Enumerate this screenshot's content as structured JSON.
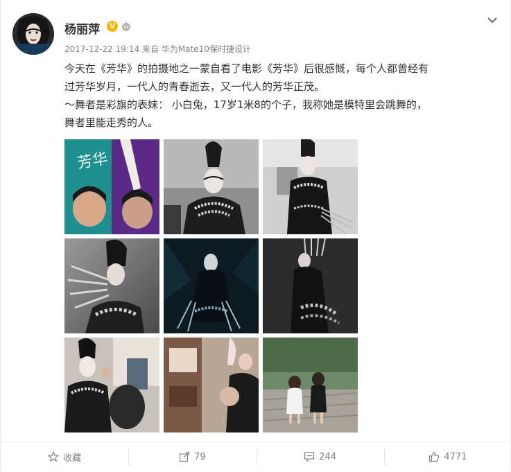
{
  "post": {
    "username": "杨丽萍",
    "verified_badge": "V",
    "timestamp": "2017-12-22 19:14",
    "source_prefix": "来自",
    "source": "华为Mate10保时捷设计",
    "text_line1": "今天在《芳华》的拍摄地之一蒙自看了电影《芳华》后很感慨，每个人都曾经有",
    "text_line2": "过芳华岁月，一代人的青春逝去，又一代人的芳华正茂。",
    "text_line3": "～舞者是彩旗的表妹： 小白兔，17岁1米8的个子，我称她是模特里会跳舞的，",
    "text_line4": "舞者里能走秀的人。",
    "poster_text": "芳华"
  },
  "icons": {
    "menu": "chevron-down-icon",
    "robot": "robot-icon",
    "favorite": "star-icon",
    "repost": "share-icon",
    "comment": "comment-icon",
    "like": "thumbs-up-icon"
  },
  "actions": {
    "favorite_label": "收藏",
    "repost_count": "79",
    "comment_count": "244",
    "like_count": "4771"
  },
  "colors": {
    "accent": "#f7b300",
    "text": "#333333",
    "muted": "#808080",
    "poster_teal": "#1f8f8f",
    "poster_purple": "#5b2a86"
  }
}
